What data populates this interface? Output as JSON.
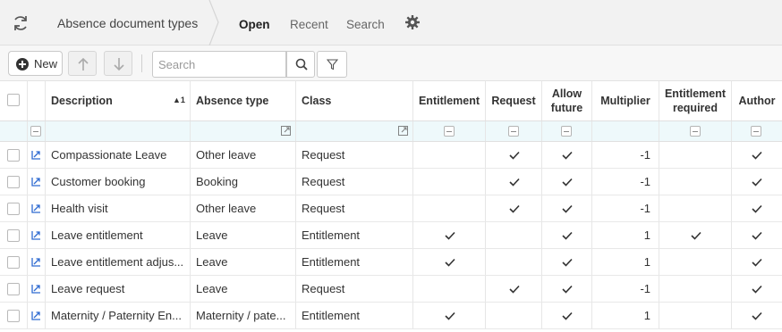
{
  "header": {
    "title": "Absence document types",
    "tabs": [
      {
        "label": "Open",
        "active": true
      },
      {
        "label": "Recent",
        "active": false
      },
      {
        "label": "Search",
        "active": false
      }
    ]
  },
  "toolbar": {
    "new_label": "New",
    "search_placeholder": "Search"
  },
  "grid": {
    "columns": {
      "description": "Description",
      "sort_indicator": "▲1",
      "absence_type": "Absence type",
      "class": "Class",
      "entitlement": "Entitlement",
      "request": "Request",
      "allow_future": "Allow future",
      "multiplier": "Multiplier",
      "entitlement_required": "Entitlement required",
      "author": "Author"
    },
    "rows": [
      {
        "description": "Compassionate Leave",
        "absence_type": "Other leave",
        "class": "Request",
        "entitlement": false,
        "request": true,
        "allow_future": true,
        "multiplier": "-1",
        "entitlement_required": false,
        "author": true
      },
      {
        "description": "Customer booking",
        "absence_type": "Booking",
        "class": "Request",
        "entitlement": false,
        "request": true,
        "allow_future": true,
        "multiplier": "-1",
        "entitlement_required": false,
        "author": true
      },
      {
        "description": "Health visit",
        "absence_type": "Other leave",
        "class": "Request",
        "entitlement": false,
        "request": true,
        "allow_future": true,
        "multiplier": "-1",
        "entitlement_required": false,
        "author": true
      },
      {
        "description": "Leave entitlement",
        "absence_type": "Leave",
        "class": "Entitlement",
        "entitlement": true,
        "request": false,
        "allow_future": true,
        "multiplier": "1",
        "entitlement_required": true,
        "author": true
      },
      {
        "description": "Leave entitlement adjus...",
        "absence_type": "Leave",
        "class": "Entitlement",
        "entitlement": true,
        "request": false,
        "allow_future": true,
        "multiplier": "1",
        "entitlement_required": false,
        "author": true
      },
      {
        "description": "Leave request",
        "absence_type": "Leave",
        "class": "Request",
        "entitlement": false,
        "request": true,
        "allow_future": true,
        "multiplier": "-1",
        "entitlement_required": false,
        "author": true
      },
      {
        "description": "Maternity / Paternity En...",
        "absence_type": "Maternity / pate...",
        "class": "Entitlement",
        "entitlement": true,
        "request": false,
        "allow_future": true,
        "multiplier": "1",
        "entitlement_required": false,
        "author": true
      }
    ]
  },
  "icons": {
    "refresh": "refresh-icon",
    "settings": "gear-icon",
    "new": "plus-circle-icon",
    "move_up": "arrow-up-icon",
    "move_down": "arrow-down-icon",
    "search": "search-icon",
    "filter": "filter-icon",
    "row_open": "open-record-icon",
    "check": "check-icon"
  },
  "colors": {
    "accent": "#2e6ad1",
    "filter_row_bg": "#eef9fb",
    "header_bg": "#f2f2f2"
  }
}
